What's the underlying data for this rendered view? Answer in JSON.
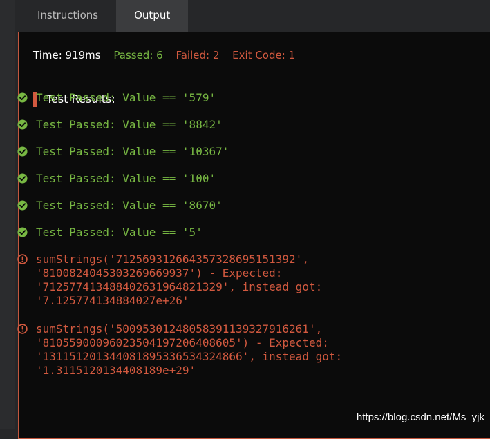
{
  "tabs": [
    {
      "label": "Instructions",
      "active": false
    },
    {
      "label": "Output",
      "active": true
    }
  ],
  "stats": {
    "time": "Time: 919ms",
    "passed": "Passed: 6",
    "failed": "Failed: 2",
    "exit_code": "Exit Code: 1"
  },
  "results_title": "Test Results:",
  "passed_tests": [
    "Test Passed: Value == '579'",
    "Test Passed: Value == '8842'",
    "Test Passed: Value == '10367'",
    "Test Passed: Value == '100'",
    "Test Passed: Value == '8670'",
    "Test Passed: Value == '5'"
  ],
  "failed_tests": [
    {
      "lines": [
        "sumStrings('712569312664357328695151392',",
        "'8100824045303269669937') - Expected:",
        "'712577413488402631964821329', instead got:",
        "'7.125774134884027e+26'"
      ]
    },
    {
      "lines": [
        "sumStrings('50095301248058391139327916261',",
        "'81055900096023504197206408605') - Expected:",
        "'131151201344081895336534324866', instead got:",
        "'1.3115120134408189e+29'"
      ]
    }
  ],
  "watermark": "https://blog.csdn.net/Ms_yjk",
  "colors": {
    "pass": "#78b843",
    "fail": "#d2593f",
    "accent_border": "#c2573e"
  },
  "icons": {
    "pass": "check-circle-icon",
    "fail": "error-circle-icon"
  }
}
